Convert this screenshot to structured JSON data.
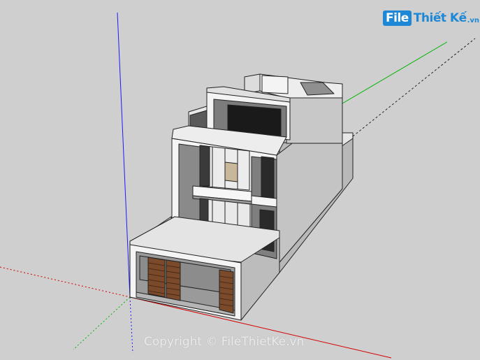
{
  "watermark": {
    "logo_file": "File",
    "logo_name": "Thiết Kế",
    "logo_tld": ".vn",
    "copyright": "Copyright © FileThietKe.vn"
  },
  "colors": {
    "background": "#cfcfcf",
    "axis_red": "#d40000",
    "axis_green": "#00b400",
    "axis_blue": "#1a1aff",
    "wall_white": "#f4f4f4",
    "wall_shade": "#bdbdbd",
    "wall_grey": "#8a8a8a",
    "glass_dark": "#1a1a1a",
    "door_wood": "#7a4a2a",
    "logo_blue": "#1e88d6"
  }
}
